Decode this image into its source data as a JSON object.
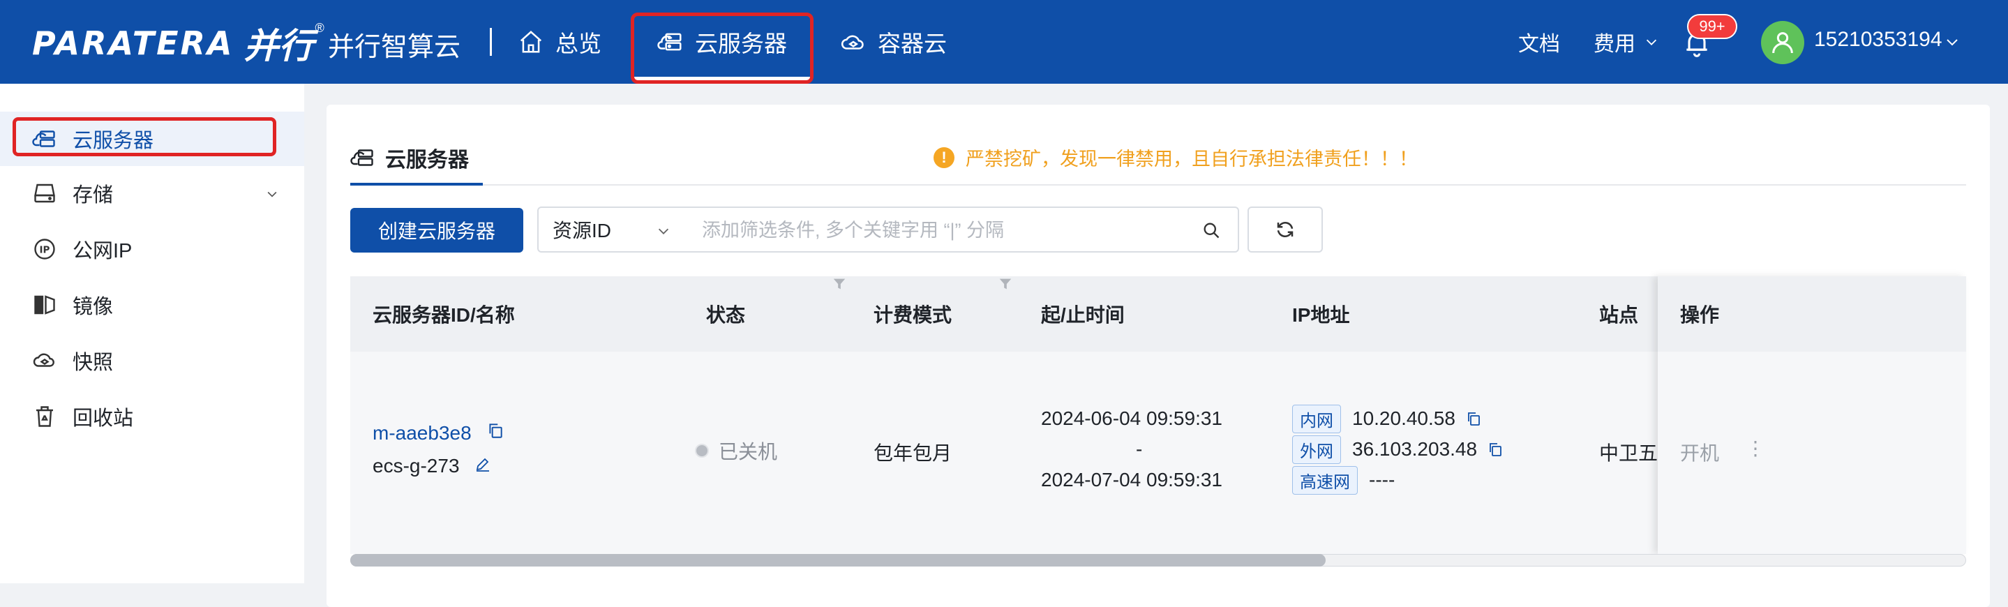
{
  "header": {
    "logo_text": "PARATERA",
    "logo_cn": "并行",
    "logo_mark": "®",
    "product_name": "并行智算云",
    "nav": [
      {
        "label": "总览",
        "icon": "home-icon"
      },
      {
        "label": "云服务器",
        "icon": "cloud-server-icon",
        "active": true
      },
      {
        "label": "容器云",
        "icon": "container-cloud-icon"
      }
    ],
    "docs_label": "文档",
    "fee_label": "费用",
    "notification_badge": "99+",
    "username": "15210353194"
  },
  "sidebar": {
    "items": [
      {
        "label": "云服务器",
        "icon": "cloud-server-icon",
        "active": true
      },
      {
        "label": "存储",
        "icon": "storage-icon",
        "expandable": true
      },
      {
        "label": "公网IP",
        "icon": "ip-icon"
      },
      {
        "label": "镜像",
        "icon": "image-icon"
      },
      {
        "label": "快照",
        "icon": "snapshot-icon"
      },
      {
        "label": "回收站",
        "icon": "recycle-bin-icon"
      }
    ]
  },
  "main": {
    "tab_label": "云服务器",
    "warning_text": "严禁挖矿，发现一律禁用，且自行承担法律责任！！！",
    "create_button": "创建云服务器",
    "filter": {
      "selected": "资源ID",
      "placeholder": "添加筛选条件, 多个关键字用 “|” 分隔"
    },
    "table": {
      "columns": [
        "云服务器ID/名称",
        "状态",
        "计费模式",
        "起/止时间",
        "IP地址",
        "站点",
        "操作"
      ],
      "rows": [
        {
          "id": "m-aaeb3e8",
          "name": "ecs-g-273",
          "status": "已关机",
          "billing": "包年包月",
          "start": "2024-06-04 09:59:31",
          "separator": "-",
          "end": "2024-07-04 09:59:31",
          "ip_internal_label": "内网",
          "ip_internal": "10.20.40.58",
          "ip_external_label": "外网",
          "ip_external": "36.103.203.48",
          "ip_highspeed_label": "高速网",
          "ip_highspeed": "----",
          "site": "中卫五",
          "op_start": "开机",
          "op_more": "⋮"
        }
      ]
    }
  },
  "colors": {
    "header_bg": "#0f4fa8",
    "accent": "#0f4fa8",
    "warning": "#f0a01e",
    "badge": "#f23c3c",
    "highlight_box": "#e02424"
  }
}
